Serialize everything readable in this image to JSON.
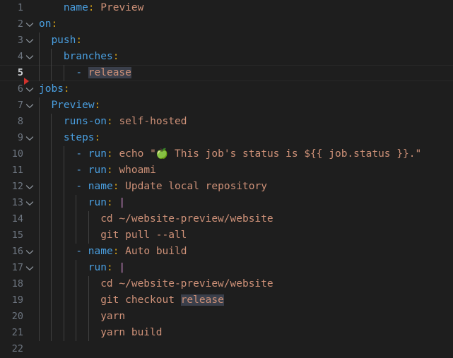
{
  "editor": {
    "language": "yaml",
    "background_color": "#1e1e1e",
    "gutter_text_color": "#6e7681",
    "current_line": 5,
    "total_lines": 22,
    "indent_guide_color": "#404040",
    "occurrence_highlight_color": "#3a3f4b",
    "marker_color": "#d1322d",
    "marker_line": 6,
    "colors": {
      "key": "#4a9fe0",
      "value": "#ce9178",
      "colon": "#d4a017",
      "dash": "#569cd6",
      "block_scalar": "#c586c0"
    },
    "fold_icon": "chevron-down-icon",
    "lines": [
      {
        "num": "1",
        "folding": false,
        "guides": 0,
        "indent": 4,
        "text": "name: Preview"
      },
      {
        "num": "2",
        "folding": true,
        "guides": 0,
        "indent": 0,
        "text": "on:"
      },
      {
        "num": "3",
        "folding": true,
        "guides": 1,
        "indent": 2,
        "text": "push:"
      },
      {
        "num": "4",
        "folding": true,
        "guides": 2,
        "indent": 4,
        "text": "branches:"
      },
      {
        "num": "5",
        "folding": false,
        "guides": 3,
        "indent": 6,
        "text": "- release"
      },
      {
        "num": "6",
        "folding": true,
        "guides": 0,
        "indent": 0,
        "text": "jobs:"
      },
      {
        "num": "7",
        "folding": true,
        "guides": 1,
        "indent": 2,
        "text": "Preview:"
      },
      {
        "num": "8",
        "folding": false,
        "guides": 2,
        "indent": 4,
        "text": "runs-on: self-hosted"
      },
      {
        "num": "9",
        "folding": true,
        "guides": 2,
        "indent": 4,
        "text": "steps:"
      },
      {
        "num": "10",
        "folding": false,
        "guides": 3,
        "indent": 6,
        "text": "- run: echo \"🍏 This job's status is ${{ job.status }}.\""
      },
      {
        "num": "11",
        "folding": false,
        "guides": 3,
        "indent": 6,
        "text": "- run: whoami"
      },
      {
        "num": "12",
        "folding": true,
        "guides": 3,
        "indent": 6,
        "text": "- name: Update local repository"
      },
      {
        "num": "13",
        "folding": true,
        "guides": 4,
        "indent": 8,
        "text": "run: |"
      },
      {
        "num": "14",
        "folding": false,
        "guides": 5,
        "indent": 10,
        "text": "cd ~/website-preview/website"
      },
      {
        "num": "15",
        "folding": false,
        "guides": 5,
        "indent": 10,
        "text": "git pull --all"
      },
      {
        "num": "16",
        "folding": true,
        "guides": 3,
        "indent": 6,
        "text": "- name: Auto build"
      },
      {
        "num": "17",
        "folding": true,
        "guides": 4,
        "indent": 8,
        "text": "run: |"
      },
      {
        "num": "18",
        "folding": false,
        "guides": 5,
        "indent": 10,
        "text": "cd ~/website-preview/website"
      },
      {
        "num": "19",
        "folding": false,
        "guides": 5,
        "indent": 10,
        "text": "git checkout release"
      },
      {
        "num": "20",
        "folding": false,
        "guides": 5,
        "indent": 10,
        "text": "yarn"
      },
      {
        "num": "21",
        "folding": false,
        "guides": 5,
        "indent": 10,
        "text": "yarn build"
      },
      {
        "num": "22",
        "folding": false,
        "guides": 0,
        "indent": 0,
        "text": ""
      }
    ],
    "tokens": [
      [
        {
          "t": "name",
          "c": "k"
        },
        {
          "t": ":",
          "c": "p"
        },
        {
          "t": " Preview",
          "c": "s"
        }
      ],
      [
        {
          "t": "on",
          "c": "k"
        },
        {
          "t": ":",
          "c": "p"
        }
      ],
      [
        {
          "t": "push",
          "c": "k"
        },
        {
          "t": ":",
          "c": "p"
        }
      ],
      [
        {
          "t": "branches",
          "c": "k"
        },
        {
          "t": ":",
          "c": "p"
        }
      ],
      [
        {
          "t": "- ",
          "c": "d"
        },
        {
          "t": "release",
          "c": "s hl"
        }
      ],
      [
        {
          "t": "jobs",
          "c": "k"
        },
        {
          "t": ":",
          "c": "p"
        }
      ],
      [
        {
          "t": "Preview",
          "c": "k"
        },
        {
          "t": ":",
          "c": "p"
        }
      ],
      [
        {
          "t": "runs-on",
          "c": "k"
        },
        {
          "t": ":",
          "c": "p"
        },
        {
          "t": " self-hosted",
          "c": "s"
        }
      ],
      [
        {
          "t": "steps",
          "c": "k"
        },
        {
          "t": ":",
          "c": "p"
        }
      ],
      [
        {
          "t": "- ",
          "c": "d"
        },
        {
          "t": "run",
          "c": "k"
        },
        {
          "t": ":",
          "c": "p"
        },
        {
          "t": " echo \"",
          "c": "s"
        },
        {
          "t": "🍏",
          "c": "emoji"
        },
        {
          "t": " This job's status is ${{ job.status }}.\"",
          "c": "s"
        }
      ],
      [
        {
          "t": "- ",
          "c": "d"
        },
        {
          "t": "run",
          "c": "k"
        },
        {
          "t": ":",
          "c": "p"
        },
        {
          "t": " whoami",
          "c": "s"
        }
      ],
      [
        {
          "t": "- ",
          "c": "d"
        },
        {
          "t": "name",
          "c": "k"
        },
        {
          "t": ":",
          "c": "p"
        },
        {
          "t": " Update local repository",
          "c": "s"
        }
      ],
      [
        {
          "t": "run",
          "c": "k"
        },
        {
          "t": ":",
          "c": "p"
        },
        {
          "t": " ",
          "c": "s"
        },
        {
          "t": "|",
          "c": "blk"
        }
      ],
      [
        {
          "t": "cd ~/website-preview/website",
          "c": "s"
        }
      ],
      [
        {
          "t": "git pull --all",
          "c": "s"
        }
      ],
      [
        {
          "t": "- ",
          "c": "d"
        },
        {
          "t": "name",
          "c": "k"
        },
        {
          "t": ":",
          "c": "p"
        },
        {
          "t": " Auto build",
          "c": "s"
        }
      ],
      [
        {
          "t": "run",
          "c": "k"
        },
        {
          "t": ":",
          "c": "p"
        },
        {
          "t": " ",
          "c": "s"
        },
        {
          "t": "|",
          "c": "blk"
        }
      ],
      [
        {
          "t": "cd ~/website-preview/website",
          "c": "s"
        }
      ],
      [
        {
          "t": "git checkout ",
          "c": "s"
        },
        {
          "t": "release",
          "c": "s hl"
        }
      ],
      [
        {
          "t": "yarn",
          "c": "s"
        }
      ],
      [
        {
          "t": "yarn build",
          "c": "s"
        }
      ],
      []
    ]
  }
}
